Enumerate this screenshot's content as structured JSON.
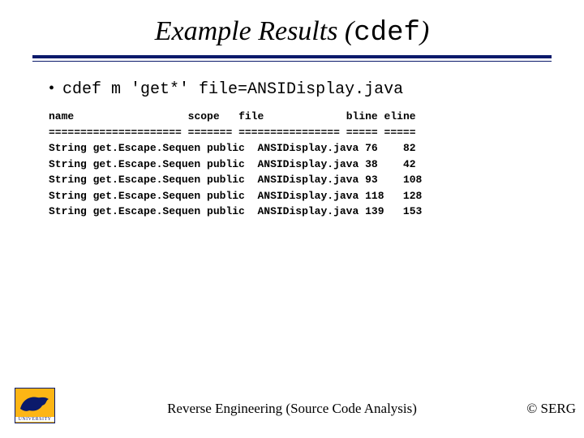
{
  "title_prefix": "Example Results (",
  "title_mono": "cdef",
  "title_suffix": ")",
  "command": "cdef m 'get*' file=ANSIDisplay.java",
  "headers": {
    "name": "name",
    "scope": "scope",
    "file": "file",
    "bline": "bline",
    "eline": "eline"
  },
  "separators": {
    "name": "=====================",
    "scope": "=======",
    "file": "================",
    "bline": "=====",
    "eline": "====="
  },
  "rows": [
    {
      "name": "String get.Escape.Sequen",
      "scope": "public",
      "file": "ANSIDisplay.java",
      "bline": "76",
      "eline": "82"
    },
    {
      "name": "String get.Escape.Sequen",
      "scope": "public",
      "file": "ANSIDisplay.java",
      "bline": "38",
      "eline": "42"
    },
    {
      "name": "String get.Escape.Sequen",
      "scope": "public",
      "file": "ANSIDisplay.java",
      "bline": "93",
      "eline": "108"
    },
    {
      "name": "String get.Escape.Sequen",
      "scope": "public",
      "file": "ANSIDisplay.java",
      "bline": "118",
      "eline": "128"
    },
    {
      "name": "String get.Escape.Sequen",
      "scope": "public",
      "file": "ANSIDisplay.java",
      "bline": "139",
      "eline": "153"
    }
  ],
  "footer_center": "Reverse Engineering (Source Code Analysis)",
  "footer_right": "© SERG",
  "logo_caption": "UNIVERSITY"
}
